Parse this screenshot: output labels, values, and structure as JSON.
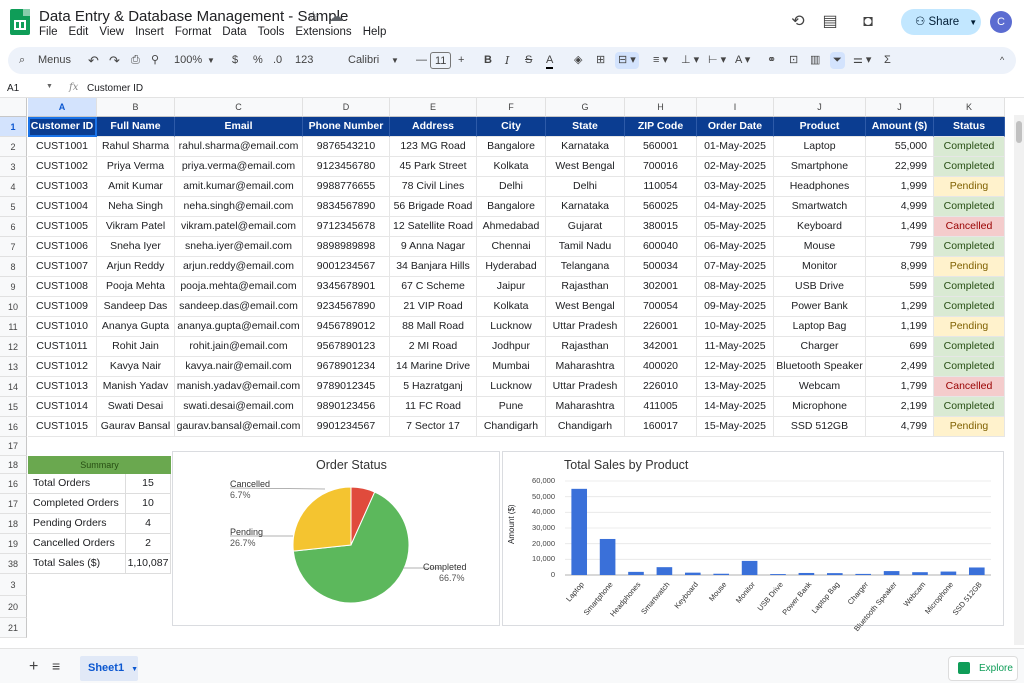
{
  "app": {
    "doc_title": "Data Entry & Database Management - Sample",
    "menu": [
      "File",
      "Edit",
      "View",
      "Insert",
      "Format",
      "Data",
      "Tools",
      "Extensions",
      "Help"
    ],
    "share_label": "Share",
    "avatar_letter": "C"
  },
  "toolbar": {
    "menus_label": "Menus",
    "zoom": "100%",
    "currency": "$",
    "percent": "%",
    "dec_decrease": ".0",
    "dec_increase": "123",
    "font": "Calibri",
    "font_size": "11"
  },
  "formula_bar": {
    "cell_ref": "A1",
    "fx": "fx",
    "content": "Customer ID"
  },
  "columns": [
    "A",
    "B",
    "C",
    "D",
    "E",
    "F",
    "G",
    "H",
    "I",
    "J",
    "K"
  ],
  "headers": [
    "Customer ID",
    "Full Name",
    "Email",
    "Phone Number",
    "Address",
    "City",
    "State",
    "ZIP Code",
    "Order Date",
    "Product",
    "Amount ($)",
    "Status"
  ],
  "rows": [
    [
      "CUST1001",
      "Rahul Sharma",
      "rahul.sharma@email.com",
      "9876543210",
      "123 MG Road",
      "Bangalore",
      "Karnataka",
      "560001",
      "01-May-2025",
      "Laptop",
      "55,000",
      "Completed"
    ],
    [
      "CUST1002",
      "Priya Verma",
      "priya.verma@email.com",
      "9123456780",
      "45 Park Street",
      "Kolkata",
      "West Bengal",
      "700016",
      "02-May-2025",
      "Smartphone",
      "22,999",
      "Completed"
    ],
    [
      "CUST1003",
      "Amit Kumar",
      "amit.kumar@email.com",
      "9988776655",
      "78 Civil Lines",
      "Delhi",
      "Delhi",
      "110054",
      "03-May-2025",
      "Headphones",
      "1,999",
      "Pending"
    ],
    [
      "CUST1004",
      "Neha Singh",
      "neha.singh@email.com",
      "9834567890",
      "56 Brigade Road",
      "Bangalore",
      "Karnataka",
      "560025",
      "04-May-2025",
      "Smartwatch",
      "4,999",
      "Completed"
    ],
    [
      "CUST1005",
      "Vikram Patel",
      "vikram.patel@email.com",
      "9712345678",
      "12 Satellite Road",
      "Ahmedabad",
      "Gujarat",
      "380015",
      "05-May-2025",
      "Keyboard",
      "1,499",
      "Cancelled"
    ],
    [
      "CUST1006",
      "Sneha Iyer",
      "sneha.iyer@email.com",
      "9898989898",
      "9 Anna Nagar",
      "Chennai",
      "Tamil Nadu",
      "600040",
      "06-May-2025",
      "Mouse",
      "799",
      "Completed"
    ],
    [
      "CUST1007",
      "Arjun Reddy",
      "arjun.reddy@email.com",
      "9001234567",
      "34 Banjara Hills",
      "Hyderabad",
      "Telangana",
      "500034",
      "07-May-2025",
      "Monitor",
      "8,999",
      "Pending"
    ],
    [
      "CUST1008",
      "Pooja Mehta",
      "pooja.mehta@email.com",
      "9345678901",
      "67 C Scheme",
      "Jaipur",
      "Rajasthan",
      "302001",
      "08-May-2025",
      "USB Drive",
      "599",
      "Completed"
    ],
    [
      "CUST1009",
      "Sandeep Das",
      "sandeep.das@email.com",
      "9234567890",
      "21 VIP Road",
      "Kolkata",
      "West Bengal",
      "700054",
      "09-May-2025",
      "Power Bank",
      "1,299",
      "Completed"
    ],
    [
      "CUST1010",
      "Ananya Gupta",
      "ananya.gupta@email.com",
      "9456789012",
      "88 Mall Road",
      "Lucknow",
      "Uttar Pradesh",
      "226001",
      "10-May-2025",
      "Laptop Bag",
      "1,199",
      "Pending"
    ],
    [
      "CUST1011",
      "Rohit Jain",
      "rohit.jain@email.com",
      "9567890123",
      "2 MI Road",
      "Jodhpur",
      "Rajasthan",
      "342001",
      "11-May-2025",
      "Charger",
      "699",
      "Completed"
    ],
    [
      "CUST1012",
      "Kavya Nair",
      "kavya.nair@email.com",
      "9678901234",
      "14 Marine Drive",
      "Mumbai",
      "Maharashtra",
      "400020",
      "12-May-2025",
      "Bluetooth Speaker",
      "2,499",
      "Completed"
    ],
    [
      "CUST1013",
      "Manish Yadav",
      "manish.yadav@email.com",
      "9789012345",
      "5 Hazratganj",
      "Lucknow",
      "Uttar Pradesh",
      "226010",
      "13-May-2025",
      "Webcam",
      "1,799",
      "Cancelled"
    ],
    [
      "CUST1014",
      "Swati Desai",
      "swati.desai@email.com",
      "9890123456",
      "11 FC Road",
      "Pune",
      "Maharashtra",
      "411005",
      "14-May-2025",
      "Microphone",
      "2,199",
      "Completed"
    ],
    [
      "CUST1015",
      "Gaurav Bansal",
      "gaurav.bansal@email.com",
      "9901234567",
      "7 Sector 17",
      "Chandigarh",
      "Chandigarh",
      "160017",
      "15-May-2025",
      "SSD 512GB",
      "4,799",
      "Pending"
    ]
  ],
  "row_numbers": [
    "1",
    "2",
    "3",
    "4",
    "5",
    "6",
    "7",
    "8",
    "9",
    "10",
    "11",
    "12",
    "13",
    "14",
    "15",
    "16",
    "17",
    "18",
    "16",
    "17",
    "18",
    "19",
    "38",
    "3",
    "20",
    "21"
  ],
  "summary": {
    "header": "Summary",
    "items": [
      {
        "label": "Total Orders",
        "value": "15"
      },
      {
        "label": "Completed Orders",
        "value": "10"
      },
      {
        "label": "Pending Orders",
        "value": "4"
      },
      {
        "label": "Cancelled Orders",
        "value": "2"
      },
      {
        "label": "Total Sales ($)",
        "value": "1,10,087"
      }
    ]
  },
  "status_colors": {
    "Completed": "#d9ead3",
    "Pending": "#fff2cc",
    "Cancelled": "#f4cccc"
  },
  "chart_data": [
    {
      "type": "pie",
      "title": "Order Status",
      "slices": [
        {
          "name": "Completed",
          "value": 66.7,
          "label": "Completed",
          "pct": "66.7%",
          "color": "#5cb85c"
        },
        {
          "name": "Pending",
          "value": 26.7,
          "label": "Pending",
          "pct": "26.7%",
          "color": "#f4c430"
        },
        {
          "name": "Cancelled",
          "value": 6.7,
          "label": "Cancelled",
          "pct": "6.7%",
          "color": "#e04b3c"
        }
      ]
    },
    {
      "type": "bar",
      "title": "Total Sales by Product",
      "ylabel": "Amount ($)",
      "ylim": [
        0,
        60000
      ],
      "yticks": [
        "0",
        "10,000",
        "20,000",
        "30,000",
        "40,000",
        "50,000",
        "60,000"
      ],
      "color": "#3a70d9",
      "categories": [
        "Laptop",
        "Smartphone",
        "Headphones",
        "Smartwatch",
        "Keyboard",
        "Mouse",
        "Monitor",
        "USB Drive",
        "Power Bank",
        "Laptop Bag",
        "Charger",
        "Bluetooth Speaker",
        "Webcam",
        "Microphone",
        "SSD 512GB"
      ],
      "values": [
        55000,
        22999,
        1999,
        4999,
        1499,
        799,
        8999,
        599,
        1299,
        1199,
        699,
        2499,
        1799,
        2199,
        4799
      ]
    }
  ],
  "sheet": {
    "tab": "Sheet1",
    "explore": "Explore"
  }
}
